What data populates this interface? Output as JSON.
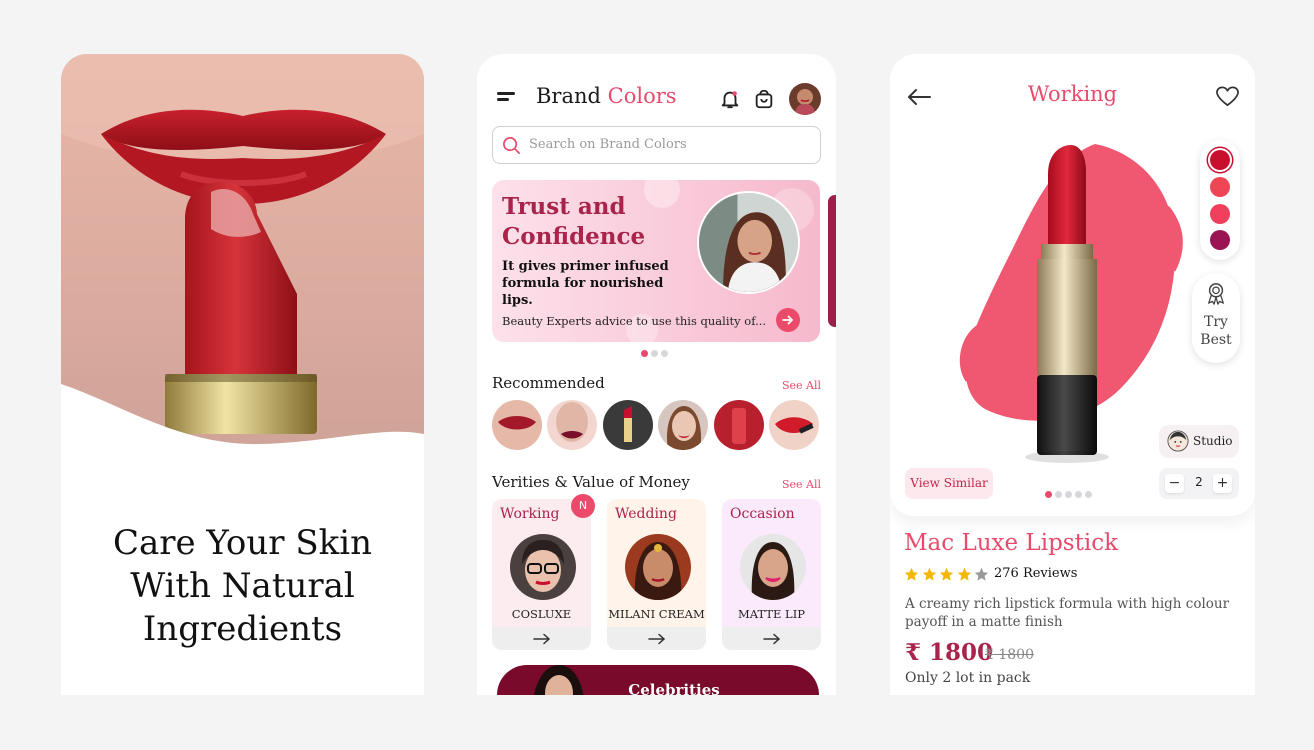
{
  "screen1": {
    "headline_lines": [
      "Care Your Skin",
      "With Natural",
      "Ingredients"
    ]
  },
  "screen2": {
    "brand": "Brand",
    "brand_accent": "Colors",
    "search_placeholder": "Search on Brand Colors",
    "banner": {
      "title": "Trust and Confidence",
      "subtitle": "It gives primer infused formula for nourished lips.",
      "footer": "Beauty Experts advice to use this quality of...",
      "dots": 3,
      "active_dot": 0
    },
    "recommended": {
      "title": "Recommended",
      "see_all": "See All"
    },
    "varieties": {
      "title": "Verities & Value of Money",
      "see_all": "See All",
      "badge": "N",
      "cards": [
        {
          "label": "Working",
          "name": "COSLUXE",
          "bg": "#fdecef"
        },
        {
          "label": "Wedding",
          "name": "MILANI CREAM",
          "bg": "#fff3ea"
        },
        {
          "label": "Occasion",
          "name": "MATTE LIP",
          "bg": "#fbeafb"
        }
      ]
    },
    "celebrities": "Celebrities"
  },
  "screen3": {
    "title": "Working",
    "swatches": [
      "#c8102e",
      "#ef4656",
      "#f0405e",
      "#9b1553"
    ],
    "try_best": [
      "Try",
      "Best"
    ],
    "studio": "Studio",
    "view_similar": "View Similar",
    "quantity": "2",
    "qty_minus": "−",
    "qty_plus": "+",
    "image_dots": 5,
    "active_image_dot": 0,
    "product_name": "Mac Luxe Lipstick",
    "rating": 4,
    "rating_max": 5,
    "reviews": "276 Reviews",
    "description": "A creamy rich lipstick formula with high colour payoff in a matte finish",
    "price": "₹ 1800",
    "old_price": "₹ 1800",
    "stock_note": "Only 2 lot in pack"
  },
  "colors": {
    "accent": "#e84a6b",
    "deep": "#a8244b",
    "page_bg": "#f4f4f5"
  }
}
